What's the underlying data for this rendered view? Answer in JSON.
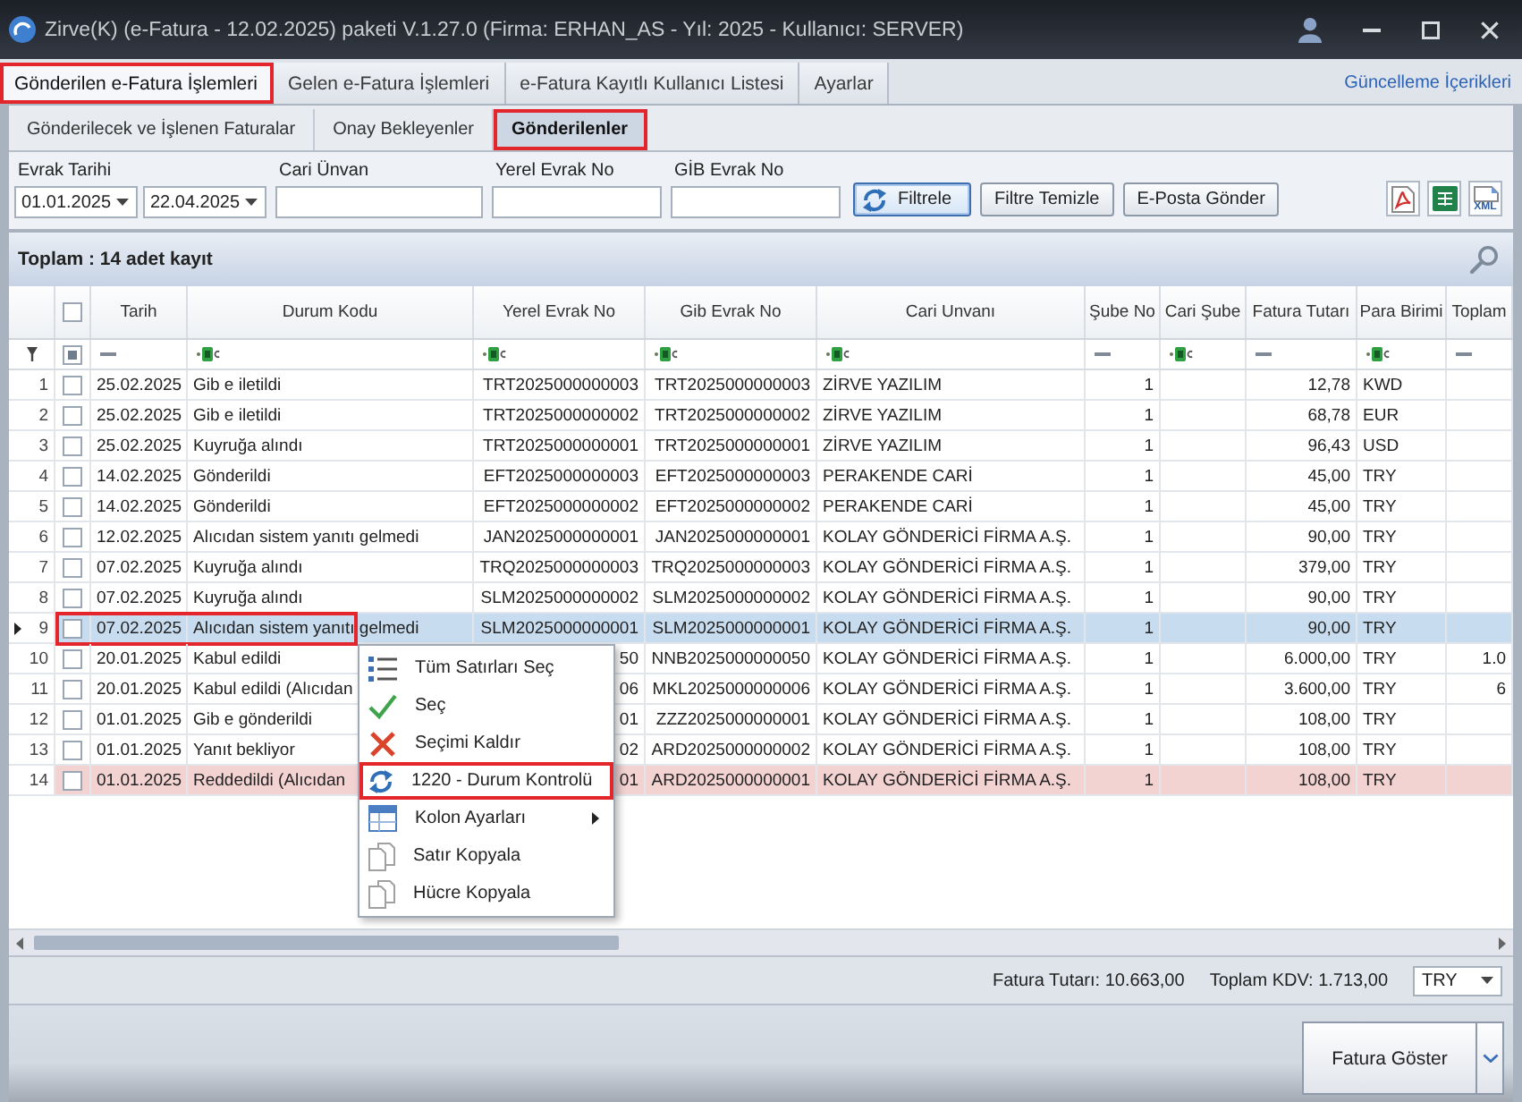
{
  "window": {
    "title": "Zirve(K) (e-Fatura - 12.02.2025) paketi V.1.27.0 (Firma: ERHAN_AS - Yıl: 2025 - Kullanıcı: SERVER)"
  },
  "tabs": [
    {
      "label": "Gönderilen e-Fatura İşlemleri",
      "selected": true,
      "annotated": true
    },
    {
      "label": "Gelen e-Fatura İşlemleri",
      "selected": false,
      "annotated": false
    },
    {
      "label": "e-Fatura Kayıtlı Kullanıcı Listesi",
      "selected": false,
      "annotated": false
    },
    {
      "label": "Ayarlar",
      "selected": false,
      "annotated": false
    }
  ],
  "update_link": "Güncelleme İçerikleri",
  "sub_tabs": [
    {
      "label": "Gönderilecek ve İşlenen Faturalar",
      "selected": false,
      "annotated": false
    },
    {
      "label": "Onay Bekleyenler",
      "selected": false,
      "annotated": false
    },
    {
      "label": "Gönderilenler",
      "selected": true,
      "annotated": true
    }
  ],
  "filter": {
    "fields": [
      {
        "label": "Evrak Tarihi",
        "kind": "date_range",
        "values": [
          "01.01.2025",
          "22.04.2025"
        ]
      },
      {
        "label": "Cari Ünvan",
        "kind": "text"
      },
      {
        "label": "Yerel Evrak No",
        "kind": "text"
      },
      {
        "label": "GİB Evrak No",
        "kind": "text"
      }
    ],
    "buttons": [
      {
        "label": "Filtrele",
        "kind": "refresh",
        "focused": true
      },
      {
        "label": "Filtre Temizle",
        "kind": "plain",
        "focused": false
      },
      {
        "label": "E-Posta Gönder",
        "kind": "plain",
        "focused": false
      }
    ],
    "export_buttons": [
      {
        "kind": "pdf"
      },
      {
        "kind": "excel"
      },
      {
        "kind": "xml",
        "label": "XML"
      }
    ]
  },
  "grid": {
    "summary": "Toplam : 14 adet kayıt",
    "select_all_checked": false,
    "filter_checkbox_indeterminate": true,
    "columns": [
      {
        "label": "Tarih",
        "kind": "date"
      },
      {
        "label": "Durum Kodu",
        "kind": "text"
      },
      {
        "label": "Yerel Evrak No",
        "kind": "code"
      },
      {
        "label": "Gib Evrak No",
        "kind": "code"
      },
      {
        "label": "Cari Unvanı",
        "kind": "text"
      },
      {
        "label": "Şube No",
        "kind": "number"
      },
      {
        "label": "Cari Şube",
        "kind": "text"
      },
      {
        "label": "Fatura Tutarı",
        "kind": "number"
      },
      {
        "label": "Para Birimi",
        "kind": "text"
      },
      {
        "label": "Toplam",
        "kind": "number"
      }
    ],
    "rows": [
      {
        "number": "1",
        "checked": false,
        "selected": false,
        "kind": "normal",
        "annotated": false,
        "tarih": "25.02.2025",
        "durum_kodu": "Gib e iletildi",
        "yerel_evrak_no": "TRT2025000000003",
        "gib_evrak_no": "TRT2025000000003",
        "cari_unvani": "ZİRVE YAZILIM",
        "sube_no": "1",
        "fatura_tutari": "12,78",
        "para_birimi": "KWD"
      },
      {
        "number": "2",
        "checked": false,
        "selected": false,
        "kind": "normal",
        "annotated": false,
        "tarih": "25.02.2025",
        "durum_kodu": "Gib e iletildi",
        "yerel_evrak_no": "TRT2025000000002",
        "gib_evrak_no": "TRT2025000000002",
        "cari_unvani": "ZİRVE YAZILIM",
        "sube_no": "1",
        "fatura_tutari": "68,78",
        "para_birimi": "EUR"
      },
      {
        "number": "3",
        "checked": false,
        "selected": false,
        "kind": "normal",
        "annotated": false,
        "tarih": "25.02.2025",
        "durum_kodu": "Kuyruğa alındı",
        "yerel_evrak_no": "TRT2025000000001",
        "gib_evrak_no": "TRT2025000000001",
        "cari_unvani": "ZİRVE YAZILIM",
        "sube_no": "1",
        "fatura_tutari": "96,43",
        "para_birimi": "USD"
      },
      {
        "number": "4",
        "checked": false,
        "selected": false,
        "kind": "normal",
        "annotated": false,
        "tarih": "14.02.2025",
        "durum_kodu": "Gönderildi",
        "yerel_evrak_no": "EFT2025000000003",
        "gib_evrak_no": "EFT2025000000003",
        "cari_unvani": "PERAKENDE CARİ",
        "sube_no": "1",
        "fatura_tutari": "45,00",
        "para_birimi": "TRY"
      },
      {
        "number": "5",
        "checked": false,
        "selected": false,
        "kind": "normal",
        "annotated": false,
        "tarih": "14.02.2025",
        "durum_kodu": "Gönderildi",
        "yerel_evrak_no": "EFT2025000000002",
        "gib_evrak_no": "EFT2025000000002",
        "cari_unvani": "PERAKENDE CARİ",
        "sube_no": "1",
        "fatura_tutari": "45,00",
        "para_birimi": "TRY"
      },
      {
        "number": "6",
        "checked": false,
        "selected": false,
        "kind": "normal",
        "annotated": false,
        "tarih": "12.02.2025",
        "durum_kodu": "Alıcıdan sistem yanıtı gelmedi",
        "yerel_evrak_no": "JAN2025000000001",
        "gib_evrak_no": "JAN2025000000001",
        "cari_unvani": "KOLAY GÖNDERİCİ FİRMA A.Ş.",
        "sube_no": "1",
        "fatura_tutari": "90,00",
        "para_birimi": "TRY"
      },
      {
        "number": "7",
        "checked": false,
        "selected": false,
        "kind": "normal",
        "annotated": false,
        "tarih": "07.02.2025",
        "durum_kodu": "Kuyruğa alındı",
        "yerel_evrak_no": "TRQ2025000000003",
        "gib_evrak_no": "TRQ2025000000003",
        "cari_unvani": "KOLAY GÖNDERİCİ FİRMA A.Ş.",
        "sube_no": "1",
        "fatura_tutari": "379,00",
        "para_birimi": "TRY"
      },
      {
        "number": "8",
        "checked": false,
        "selected": false,
        "kind": "normal",
        "annotated": false,
        "tarih": "07.02.2025",
        "durum_kodu": "Kuyruğa alındı",
        "yerel_evrak_no": "SLM2025000000002",
        "gib_evrak_no": "SLM2025000000002",
        "cari_unvani": "KOLAY GÖNDERİCİ FİRMA A.Ş.",
        "sube_no": "1",
        "fatura_tutari": "90,00",
        "para_birimi": "TRY"
      },
      {
        "number": "9",
        "checked": false,
        "selected": true,
        "kind": "normal",
        "annotated": true,
        "tarih": "07.02.2025",
        "durum_kodu": "Alıcıdan sistem yanıtı gelmedi",
        "yerel_evrak_no": "SLM2025000000001",
        "gib_evrak_no": "SLM2025000000001",
        "cari_unvani": "KOLAY GÖNDERİCİ FİRMA A.Ş.",
        "sube_no": "1",
        "fatura_tutari": "90,00",
        "para_birimi": "TRY"
      },
      {
        "number": "10",
        "checked": false,
        "selected": false,
        "kind": "normal",
        "annotated": false,
        "tarih": "20.01.2025",
        "durum_kodu": "Kabul edildi",
        "yerel_evrak_no": "50",
        "gib_evrak_no": "NNB2025000000050",
        "cari_unvani": "KOLAY GÖNDERİCİ FİRMA A.Ş.",
        "sube_no": "1",
        "fatura_tutari": "6.000,00",
        "para_birimi": "TRY",
        "toplam": "1.0"
      },
      {
        "number": "11",
        "checked": false,
        "selected": false,
        "kind": "normal",
        "annotated": false,
        "tarih": "20.01.2025",
        "durum_kodu": "Kabul edildi (Alıcıdan",
        "yerel_evrak_no": "06",
        "gib_evrak_no": "MKL2025000000006",
        "cari_unvani": "KOLAY GÖNDERİCİ FİRMA A.Ş.",
        "sube_no": "1",
        "fatura_tutari": "3.600,00",
        "para_birimi": "TRY",
        "toplam": "6"
      },
      {
        "number": "12",
        "checked": false,
        "selected": false,
        "kind": "normal",
        "annotated": false,
        "tarih": "01.01.2025",
        "durum_kodu": "Gib e gönderildi",
        "yerel_evrak_no": "01",
        "gib_evrak_no": "ZZZ2025000000001",
        "cari_unvani": "KOLAY GÖNDERİCİ FİRMA A.Ş.",
        "sube_no": "1",
        "fatura_tutari": "108,00",
        "para_birimi": "TRY"
      },
      {
        "number": "13",
        "checked": false,
        "selected": false,
        "kind": "normal",
        "annotated": false,
        "tarih": "01.01.2025",
        "durum_kodu": "Yanıt bekliyor",
        "yerel_evrak_no": "02",
        "gib_evrak_no": "ARD2025000000002",
        "cari_unvani": "KOLAY GÖNDERİCİ FİRMA A.Ş.",
        "sube_no": "1",
        "fatura_tutari": "108,00",
        "para_birimi": "TRY"
      },
      {
        "number": "14",
        "checked": false,
        "selected": false,
        "kind": "error",
        "annotated": false,
        "tarih": "01.01.2025",
        "durum_kodu": "Reddedildi (Alıcıdan",
        "yerel_evrak_no": "01",
        "gib_evrak_no": "ARD2025000000001",
        "cari_unvani": "KOLAY GÖNDERİCİ FİRMA A.Ş.",
        "sube_no": "1",
        "fatura_tutari": "108,00",
        "para_birimi": "TRY"
      }
    ]
  },
  "context_menu": {
    "items": [
      {
        "label": "Tüm Satırları Seç",
        "submenu": false,
        "annotated": false
      },
      {
        "label": "Seç",
        "submenu": false,
        "annotated": false
      },
      {
        "label": "Seçimi Kaldır",
        "submenu": false,
        "annotated": false
      },
      {
        "label": "1220 - Durum Kontrolü",
        "submenu": false,
        "annotated": true
      },
      {
        "label": "Kolon Ayarları",
        "submenu": true,
        "annotated": false
      },
      {
        "label": "Satır Kopyala",
        "submenu": false,
        "annotated": false
      },
      {
        "label": "Hücre Kopyala",
        "submenu": false,
        "annotated": false
      }
    ]
  },
  "totals": [
    "Fatura Tutarı: 10.663,00",
    "Toplam KDV: 1.713,00"
  ],
  "currency": "TRY",
  "action_button": "Fatura Göster"
}
